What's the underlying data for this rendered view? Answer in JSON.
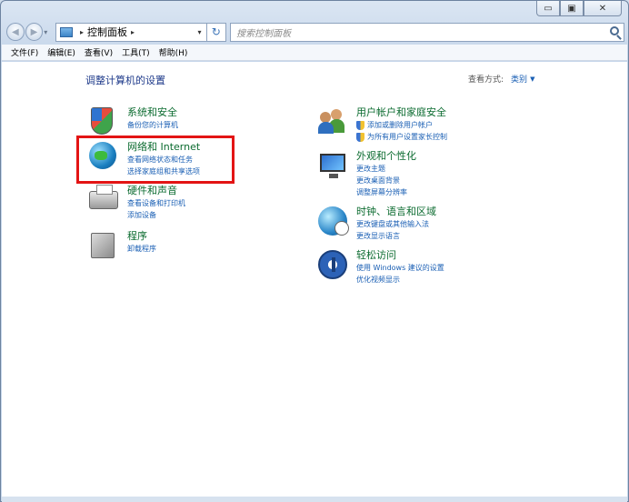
{
  "window": {
    "caption": {
      "minimize_glyph": "▭",
      "maximize_glyph": "▣",
      "close_glyph": "✕"
    }
  },
  "nav": {
    "back_glyph": "◀",
    "forward_glyph": "▶",
    "history_glyph": "▾",
    "breadcrumb": [
      "控制面板"
    ],
    "breadcrumb_sep": "▸",
    "address_dropdown_glyph": "▾",
    "refresh_glyph": "↻",
    "search_placeholder": "搜索控制面板"
  },
  "menu": {
    "items": [
      "文件(F)",
      "编辑(E)",
      "查看(V)",
      "工具(T)",
      "帮助(H)"
    ]
  },
  "main": {
    "title": "调整计算机的设置",
    "view_by_label": "查看方式:",
    "view_by_value": "类别",
    "view_by_arrow": "▼",
    "left_categories": [
      {
        "title": "系统和安全",
        "icon": "shield-icon",
        "links": [
          "备份您的计算机"
        ]
      },
      {
        "title": "网络和 Internet",
        "icon": "globe-network-icon",
        "links": [
          "查看网络状态和任务",
          "选择家庭组和共享选项"
        ]
      },
      {
        "title": "硬件和声音",
        "icon": "printer-icon",
        "links": [
          "查看设备和打印机",
          "添加设备"
        ]
      },
      {
        "title": "程序",
        "icon": "programs-box-icon",
        "links": [
          "卸载程序"
        ]
      }
    ],
    "right_categories": [
      {
        "title": "用户帐户和家庭安全",
        "icon": "users-icon",
        "links": [
          "添加或删除用户帐户",
          "为所有用户设置家长控制"
        ],
        "shield_links": [
          true,
          true
        ]
      },
      {
        "title": "外观和个性化",
        "icon": "monitor-icon",
        "links": [
          "更改主题",
          "更改桌面背景",
          "调整屏幕分辨率"
        ]
      },
      {
        "title": "时钟、语言和区域",
        "icon": "clock-globe-icon",
        "links": [
          "更改键盘或其他输入法",
          "更改显示语言"
        ]
      },
      {
        "title": "轻松访问",
        "icon": "accessibility-icon",
        "links": [
          "使用 Windows 建议的设置",
          "优化视频显示"
        ]
      }
    ]
  },
  "colors": {
    "category_title": "#0b6b2f",
    "link": "#1a5fb4",
    "highlight_box": "#e31414"
  }
}
